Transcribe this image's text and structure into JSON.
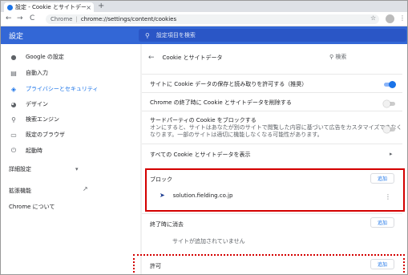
{
  "tab": {
    "title": "設定 - Cookie とサイトデータ",
    "close": "×",
    "new_tab": "+"
  },
  "toolbar": {
    "back": "←",
    "forward": "→",
    "reload": "C",
    "site_label": "Chrome",
    "separator": "|",
    "url": "chrome://settings/content/cookies",
    "star": "☆",
    "menu": "⋮"
  },
  "header": {
    "title": "設定",
    "search_placeholder": "設定項目を検索"
  },
  "sidebar": {
    "items": [
      {
        "label": "Google の設定",
        "icon": "person-icon"
      },
      {
        "label": "自動入力",
        "icon": "autofill-icon"
      },
      {
        "label": "プライバシーとセキュリティ",
        "icon": "shield-icon",
        "active": true
      },
      {
        "label": "デザイン",
        "icon": "palette-icon"
      },
      {
        "label": "検索エンジン",
        "icon": "search-icon"
      },
      {
        "label": "既定のブラウザ",
        "icon": "browser-icon"
      },
      {
        "label": "起動時",
        "icon": "power-icon"
      }
    ],
    "advanced": "詳細設定",
    "advanced_arrow": "▾",
    "extensions": "拡張機能",
    "about": "Chrome について"
  },
  "content": {
    "title": "Cookie とサイトデータ",
    "search": "検索",
    "settings": [
      {
        "label": "サイトに Cookie データの保存と読み取りを許可する（推奨）",
        "on": true
      },
      {
        "label": "Chrome の終了時に Cookie とサイトデータを削除する",
        "on": false
      }
    ],
    "third_party": {
      "label": "サードパーティの Cookie をブロックする",
      "desc1": "オンにすると、サイトはあなたが別のサイトで閲覧した内容に基づいて広告をカスタマイズできなく",
      "desc2": "なります。一部のサイトは適切に機能しなくなる可能性があります。",
      "on": false
    },
    "see_all": "すべての Cookie とサイトデータを表示",
    "arrow": "▸",
    "block": {
      "label": "ブロック",
      "add": "追加",
      "site": "solution.fielding.co.jp",
      "site_menu": "⋮"
    },
    "clear_on_exit": {
      "label": "終了時に消去",
      "add": "追加",
      "empty": "サイトが追加されていません"
    },
    "allow": {
      "label": "許可",
      "add": "追加"
    }
  },
  "colors": {
    "accent": "#3367d6",
    "highlight": "#d40000",
    "link": "#1a73e8"
  }
}
